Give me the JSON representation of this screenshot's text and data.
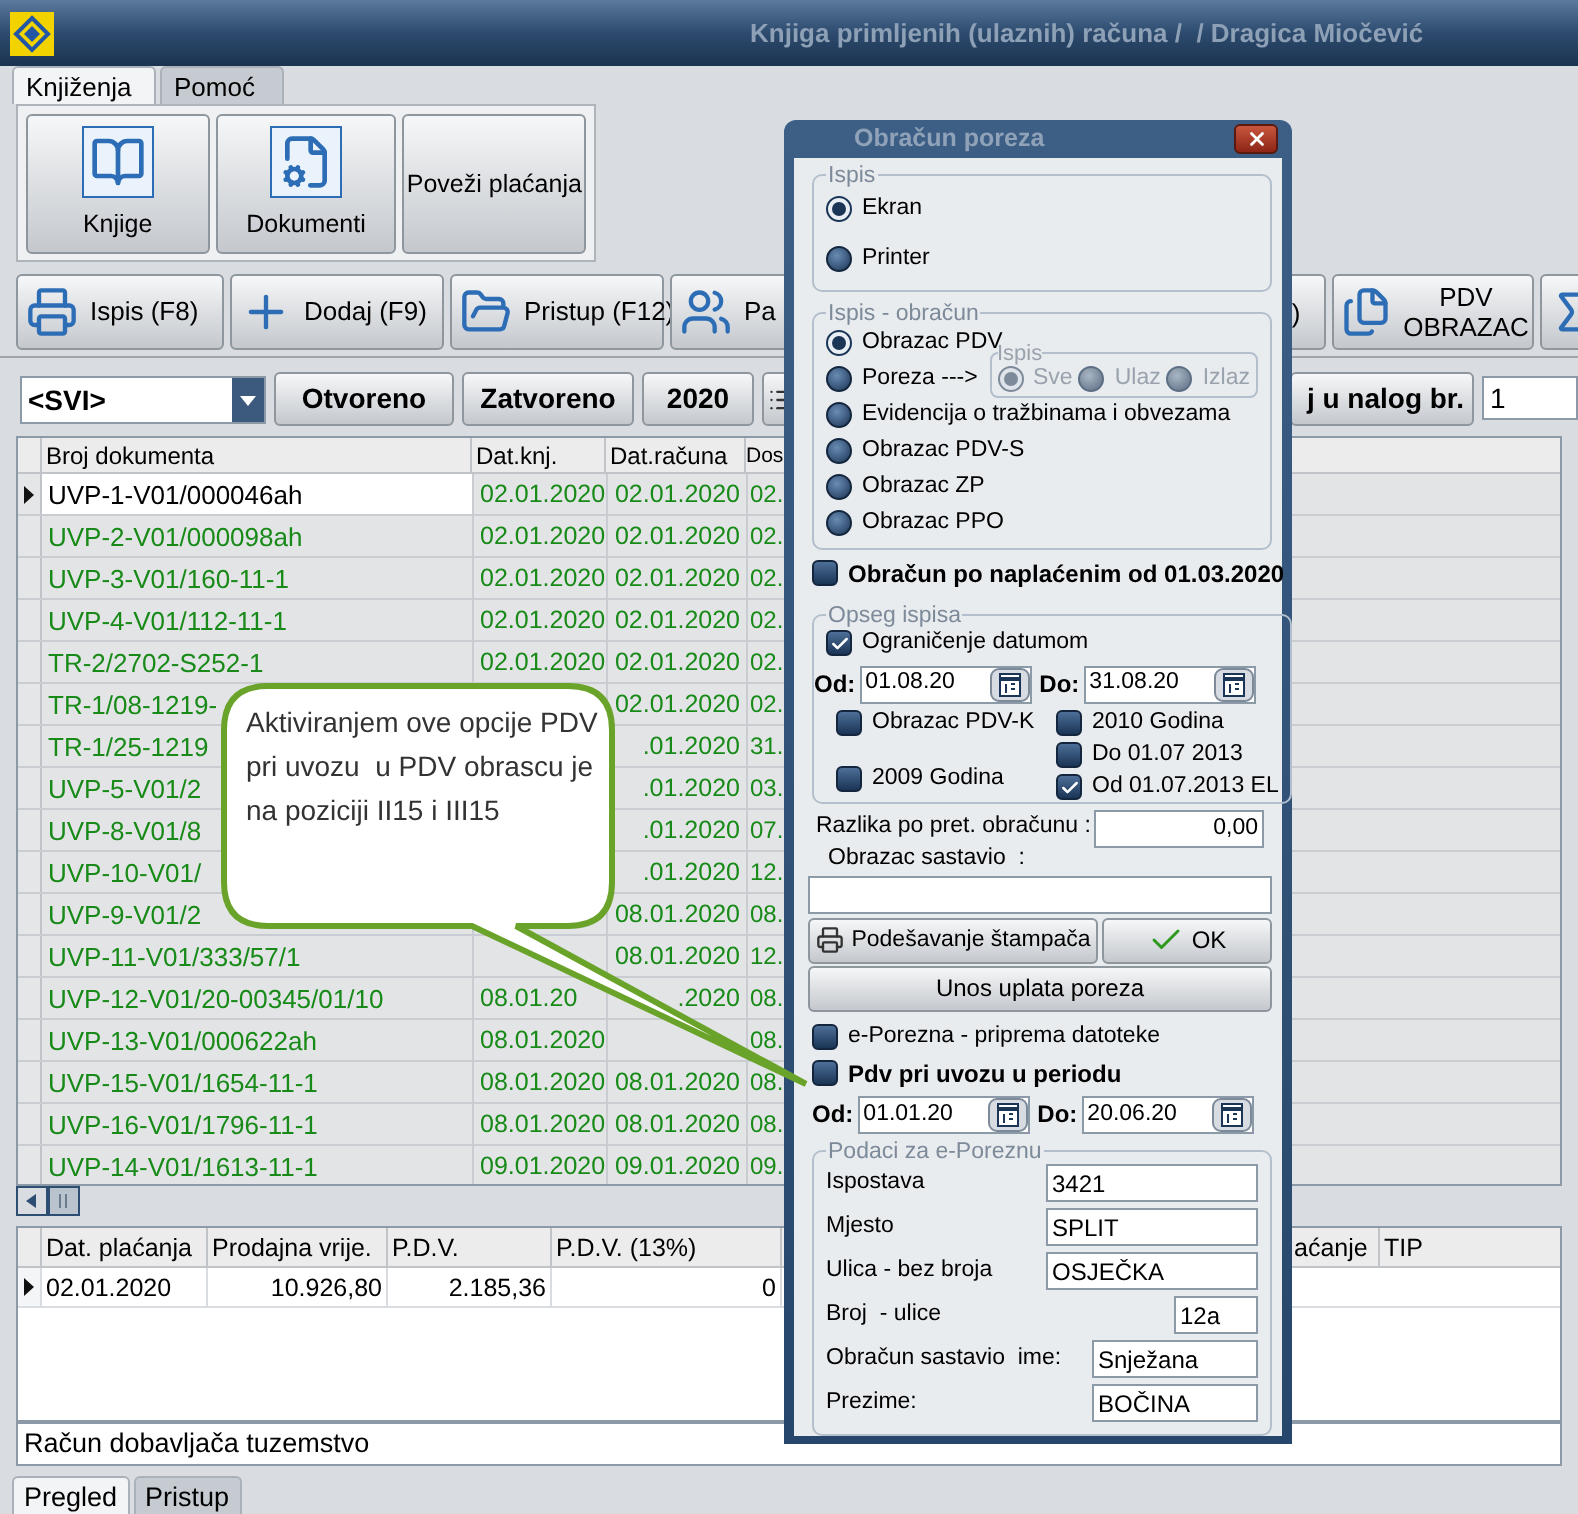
{
  "window": {
    "title": "Knjiga primljenih (ulaznih) računa /  / Dragica Miočević"
  },
  "menu_tabs": [
    {
      "label": "Knjiženja",
      "selected": true
    },
    {
      "label": "Pomoć",
      "selected": false
    }
  ],
  "ribbon_buttons": [
    {
      "label": "Knjige",
      "kind": "book"
    },
    {
      "label": "Dokumenti",
      "kind": "document"
    },
    {
      "label": "Poveži plaćanja",
      "kind": "text"
    }
  ],
  "toolbar_left": [
    {
      "label": "Ispis (F8)",
      "kind": "printer"
    },
    {
      "label": "Dodaj (F9)",
      "kind": "plus"
    },
    {
      "label": "Pristup (F12)",
      "kind": "folder"
    },
    {
      "label": "Pa",
      "kind": "people"
    }
  ],
  "toolbar_right": [
    {
      "label": ")",
      "kind": "text"
    },
    {
      "label": "PDV OBRAZAC",
      "kind": "copy"
    },
    {
      "kind": "sum"
    }
  ],
  "filter": {
    "select_value": "<SVI>",
    "buttons": [
      "Otvoreno",
      "Zatvoreno",
      "2020"
    ],
    "right_button": "j u nalog br.",
    "right_input": "1"
  },
  "table": {
    "columns": [
      "Broj dokumenta",
      "Dat.knj.",
      "Dat.računa",
      "Dos"
    ],
    "rows": [
      {
        "doc": "UVP-1-V01/000046ah",
        "dat_knj": "02.01.2020",
        "dat_racuna": "02.01.2020",
        "dos": "02.",
        "selected": true
      },
      {
        "doc": "UVP-2-V01/000098ah",
        "dat_knj": "02.01.2020",
        "dat_racuna": "02.01.2020",
        "dos": "02.",
        "selected": false
      },
      {
        "doc": "UVP-3-V01/160-11-1",
        "dat_knj": "02.01.2020",
        "dat_racuna": "02.01.2020",
        "dos": "02.",
        "selected": false
      },
      {
        "doc": "UVP-4-V01/112-11-1",
        "dat_knj": "02.01.2020",
        "dat_racuna": "02.01.2020",
        "dos": "02.",
        "selected": false
      },
      {
        "doc": "TR-2/2702-S252-1",
        "dat_knj": "02.01.2020",
        "dat_racuna": "02.01.2020",
        "dos": "02.",
        "selected": false
      },
      {
        "doc": "TR-1/08-1219-",
        "dat_racuna": "02.01.2020",
        "dos": "02.",
        "selected": false
      },
      {
        "doc": "TR-1/25-1219",
        "dat_racuna": ".01.2020",
        "dos": "31.",
        "selected": false
      },
      {
        "doc": "UVP-5-V01/2",
        "dat_racuna": ".01.2020",
        "dos": "03.",
        "selected": false
      },
      {
        "doc": "UVP-8-V01/8",
        "dat_racuna": ".01.2020",
        "dos": "07.",
        "selected": false
      },
      {
        "doc": "UVP-10-V01/",
        "dat_racuna": ".01.2020",
        "dos": "12.",
        "selected": false
      },
      {
        "doc": "UVP-9-V01/2",
        "dat_racuna": "08.01.2020",
        "dos": "08.",
        "selected": false
      },
      {
        "doc": "UVP-11-V01/333/57/1",
        "dat_racuna": "08.01.2020",
        "dos": "12.",
        "selected": false
      },
      {
        "doc": "UVP-12-V01/20-00345/01/10",
        "dat_knj": "08.01.20",
        "dat_racuna": ".2020",
        "dos": "08.",
        "selected": false
      },
      {
        "doc": "UVP-13-V01/000622ah",
        "dat_knj": "08.01.2020",
        "dos": "08.",
        "selected": false
      },
      {
        "doc": "UVP-15-V01/1654-11-1",
        "dat_knj": "08.01.2020",
        "dat_racuna": "08.01.2020",
        "dos": "08.",
        "selected": false
      },
      {
        "doc": "UVP-16-V01/1796-11-1",
        "dat_knj": "08.01.2020",
        "dat_racuna": "08.01.2020",
        "dos": "08.",
        "selected": false
      },
      {
        "doc": "UVP-14-V01/1613-11-1",
        "dat_knj": "09.01.2020",
        "dat_racuna": "09.01.2020",
        "dos": "09.",
        "selected": false
      }
    ]
  },
  "callout": {
    "text": "Aktiviranjem ove opcije PDV pri uvozu  u PDV obrascu je na poziciji II15 i III15"
  },
  "payments_table": {
    "columns": [
      "Dat. plaćanja",
      "Prodajna vrije.",
      "P.D.V.",
      "P.D.V. (13%)"
    ],
    "right_columns": [
      "aćanje",
      "TIP"
    ],
    "rows": [
      {
        "cells": [
          "02.01.2020",
          "10.926,80",
          "2.185,36",
          "0"
        ],
        "selected": true
      }
    ]
  },
  "status_text": "Račun dobavljača tuzemstvo",
  "bottom_tabs": [
    {
      "label": "Pregled",
      "selected": true
    },
    {
      "label": "Pristup",
      "selected": false
    }
  ],
  "dialog": {
    "title": "Obračun poreza",
    "output_group": {
      "label": "Ispis",
      "options": [
        {
          "label": "Ekran",
          "selected": true
        },
        {
          "label": "Printer",
          "selected": false
        }
      ]
    },
    "calc_group": {
      "label": "Ispis - obračun",
      "options": [
        {
          "label": "Obrazac PDV",
          "selected": true
        },
        {
          "label": "Poreza --->",
          "selected": false
        },
        {
          "label": "Evidencija o tražbinama i obvezama",
          "selected": false
        },
        {
          "label": "Obrazac PDV-S",
          "selected": false
        },
        {
          "label": "Obrazac ZP",
          "selected": false
        },
        {
          "label": "Obrazac PPO",
          "selected": false
        }
      ],
      "sub_group": {
        "label": "Ispis",
        "disabled": true,
        "options": [
          {
            "label": "Sve",
            "selected": true
          },
          {
            "label": "Ulaz",
            "selected": false
          },
          {
            "label": "Izlaz",
            "selected": false
          }
        ]
      }
    },
    "cash_basis": {
      "label": "Obračun po naplaćenim od 01.03.2020",
      "checked": false
    },
    "range_group": {
      "label": "Opseg ispisa",
      "date_limit": {
        "label": "Ograničenje datumom",
        "checked": true
      },
      "from": {
        "label": "Od:",
        "value": "01.08.20"
      },
      "to": {
        "label": "Do:",
        "value": "31.08.20"
      },
      "left_checks": [
        {
          "label": "Obrazac PDV-K",
          "checked": false
        },
        {
          "label": "2009 Godina",
          "checked": false
        }
      ],
      "right_checks": [
        {
          "label": "2010 Godina",
          "checked": false
        },
        {
          "label": "Do 01.07 2013",
          "checked": false
        },
        {
          "label": "Od 01.07.2013 EL",
          "checked": true
        }
      ]
    },
    "difference": {
      "label": "Razlika po pret. obračunu :",
      "value": "0,00"
    },
    "compiled_by": {
      "label": "Obrazac sastavio  :"
    },
    "buttons": [
      {
        "label": "Podešavanje štampača",
        "kind": "printer"
      },
      {
        "label": "OK",
        "kind": "check"
      }
    ],
    "payment_button": "Unos uplata poreza",
    "eporezna_check": {
      "label": "e-Porezna - priprema datoteke",
      "checked": false
    },
    "import_vat_check": {
      "label": "Pdv pri uvozu u periodu",
      "checked": false
    },
    "import_from": {
      "label": "Od:",
      "value": "01.01.20"
    },
    "import_to": {
      "label": "Do:",
      "value": "20.06.20"
    },
    "eporezna_group": {
      "label": "Podaci za e-Poreznu",
      "fields": [
        {
          "label": "Ispostava",
          "value": "3421",
          "kind": "wide"
        },
        {
          "label": "Mjesto",
          "value": "SPLIT",
          "kind": "wide"
        },
        {
          "label": "Ulica - bez broja",
          "value": "OSJEČKA",
          "kind": "wide"
        },
        {
          "label": "Broj  - ulice",
          "value": "12a",
          "kind": "short"
        },
        {
          "label": "Obračun sastavio  ime:",
          "value": "Snježana",
          "kind": "medium"
        },
        {
          "label": "Prezime:",
          "value": "BOČINA",
          "kind": "medium"
        }
      ]
    }
  }
}
